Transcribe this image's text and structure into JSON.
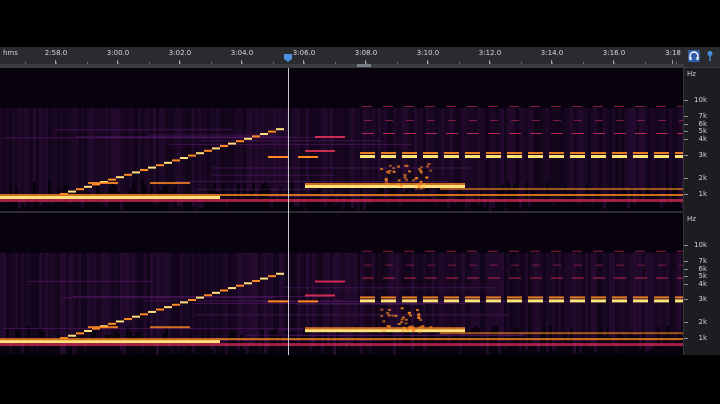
{
  "ruler": {
    "units": "hms",
    "ticks": [
      "2:58.0",
      "3:00.0",
      "3:02.0",
      "3:04.0",
      "3:06.0",
      "3:08.0",
      "3:10.0",
      "3:12.0",
      "3:14.0",
      "3:16.0",
      "3:18"
    ]
  },
  "tools": {
    "headphones_icon": "headphones-icon",
    "pin_icon": "pin-icon",
    "accent_color": "#4a8fe0"
  },
  "channels": [
    {
      "name": "top",
      "axis_unit": "Hz",
      "freq_labels": [
        "10k",
        "7k",
        "6k",
        "5k",
        "4k",
        "3k",
        "2k",
        "1k"
      ]
    },
    {
      "name": "bottom",
      "axis_unit": "Hz",
      "freq_labels": [
        "10k",
        "7k",
        "6k",
        "5k",
        "4k",
        "3k",
        "2k",
        "1k"
      ]
    }
  ],
  "colors": {
    "hot": "#ffe27a",
    "warm": "#ff8a1f",
    "mid": "#e0305a",
    "cool": "#5a1a6e",
    "background": "#07020d"
  }
}
